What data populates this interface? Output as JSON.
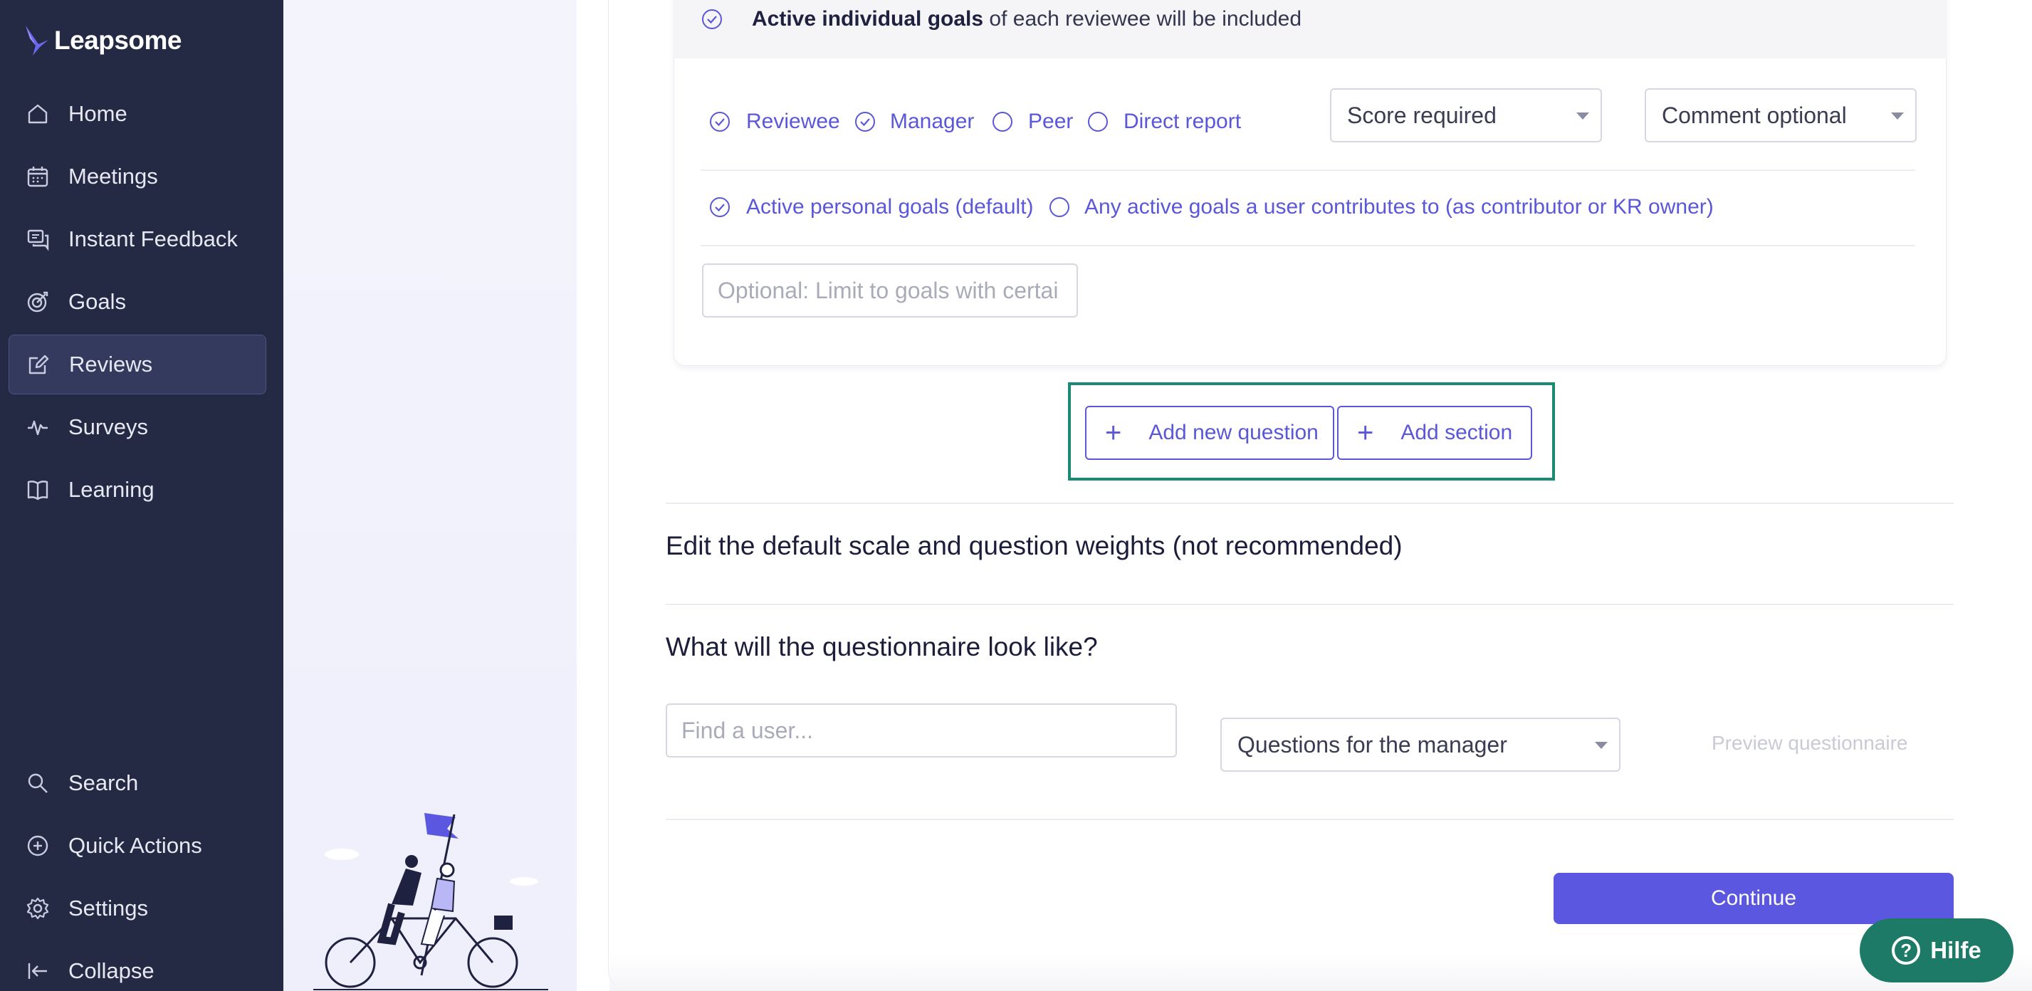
{
  "app": {
    "name": "Leapsome",
    "brand_color": "#5b57e0",
    "sidebar_bg": "#252a44"
  },
  "sidebar": {
    "items": [
      {
        "label": "Home",
        "icon": "home-icon",
        "active": false
      },
      {
        "label": "Meetings",
        "icon": "calendar-icon",
        "active": false
      },
      {
        "label": "Instant Feedback",
        "icon": "chat-icon",
        "active": false
      },
      {
        "label": "Goals",
        "icon": "target-icon",
        "active": false
      },
      {
        "label": "Reviews",
        "icon": "edit-icon",
        "active": true
      },
      {
        "label": "Surveys",
        "icon": "pulse-icon",
        "active": false
      },
      {
        "label": "Learning",
        "icon": "book-icon",
        "active": false
      }
    ],
    "bottom_items": [
      {
        "label": "Search",
        "icon": "search-icon"
      },
      {
        "label": "Quick Actions",
        "icon": "plus-circle-icon"
      },
      {
        "label": "Settings",
        "icon": "gear-icon"
      },
      {
        "label": "Collapse",
        "icon": "collapse-icon"
      }
    ]
  },
  "goals_block": {
    "header_bold": "Active individual goals",
    "header_rest": " of each reviewee will be included",
    "roles": [
      {
        "label": "Reviewee",
        "checked": true
      },
      {
        "label": "Manager",
        "checked": true
      },
      {
        "label": "Peer",
        "checked": false
      },
      {
        "label": "Direct report",
        "checked": false
      }
    ],
    "score_select": "Score required",
    "comment_select": "Comment optional",
    "goal_scope": [
      {
        "label": "Active personal goals (default)",
        "checked": true
      },
      {
        "label": "Any active goals a user contributes to (as contributor or KR owner)",
        "checked": false
      }
    ],
    "limit_placeholder": "Optional: Limit to goals with certai"
  },
  "actions": {
    "add_question": "Add new question",
    "add_section": "Add section"
  },
  "sections": {
    "scale_title": "Edit the default scale and question weights (not recommended)",
    "questionnaire_title": "What will the questionnaire look like?"
  },
  "questionnaire": {
    "user_placeholder": "Find a user...",
    "view_select": "Questions for the manager",
    "preview_link": "Preview questionnaire"
  },
  "footer": {
    "continue": "Continue",
    "help": "Hilfe"
  }
}
